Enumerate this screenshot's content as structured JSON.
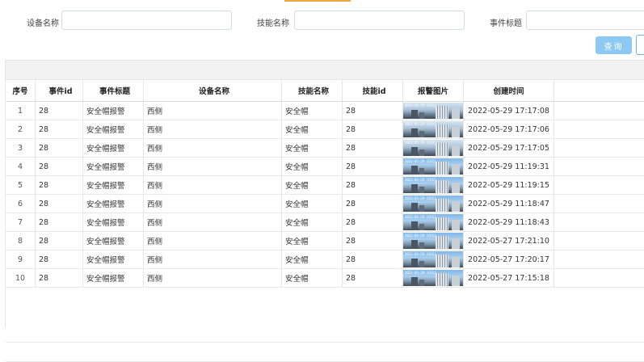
{
  "filters": {
    "device_name_label": "设备名称",
    "skill_name_label": "技能名称",
    "event_title_label": "事件标题",
    "device_name_value": "",
    "skill_name_value": "",
    "event_title_value": ""
  },
  "buttons": {
    "query": "查询"
  },
  "table": {
    "headers": [
      "序号",
      "事件id",
      "事件标题",
      "设备名称",
      "技能名称",
      "技能id",
      "报警图片",
      "创建时间"
    ],
    "rows": [
      {
        "no": "1",
        "event_id": "28",
        "event_title": "安全帽报警",
        "device_name": "西侧",
        "skill_name": "安全帽",
        "skill_id": "28",
        "created": "2022-05-29 17:17:08"
      },
      {
        "no": "2",
        "event_id": "28",
        "event_title": "安全帽报警",
        "device_name": "西侧",
        "skill_name": "安全帽",
        "skill_id": "28",
        "created": "2022-05-29 17:17:06"
      },
      {
        "no": "3",
        "event_id": "28",
        "event_title": "安全帽报警",
        "device_name": "西侧",
        "skill_name": "安全帽",
        "skill_id": "28",
        "created": "2022-05-29 17:17:05"
      },
      {
        "no": "4",
        "event_id": "28",
        "event_title": "安全帽报警",
        "device_name": "西侧",
        "skill_name": "安全帽",
        "skill_id": "28",
        "created": "2022-05-29 11:19:31"
      },
      {
        "no": "5",
        "event_id": "28",
        "event_title": "安全帽报警",
        "device_name": "西侧",
        "skill_name": "安全帽",
        "skill_id": "28",
        "created": "2022-05-29 11:19:15"
      },
      {
        "no": "6",
        "event_id": "28",
        "event_title": "安全帽报警",
        "device_name": "西侧",
        "skill_name": "安全帽",
        "skill_id": "28",
        "created": "2022-05-29 11:18:47"
      },
      {
        "no": "7",
        "event_id": "28",
        "event_title": "安全帽报警",
        "device_name": "西侧",
        "skill_name": "安全帽",
        "skill_id": "28",
        "created": "2022-05-29 11:18:43"
      },
      {
        "no": "8",
        "event_id": "28",
        "event_title": "安全帽报警",
        "device_name": "西侧",
        "skill_name": "安全帽",
        "skill_id": "28",
        "created": "2022-05-27 17:21:10"
      },
      {
        "no": "9",
        "event_id": "28",
        "event_title": "安全帽报警",
        "device_name": "西侧",
        "skill_name": "安全帽",
        "skill_id": "28",
        "created": "2022-05-27 17:20:17"
      },
      {
        "no": "10",
        "event_id": "28",
        "event_title": "安全帽报警",
        "device_name": "西侧",
        "skill_name": "安全帽",
        "skill_id": "28",
        "created": "2022-05-27 17:15:18"
      }
    ]
  }
}
